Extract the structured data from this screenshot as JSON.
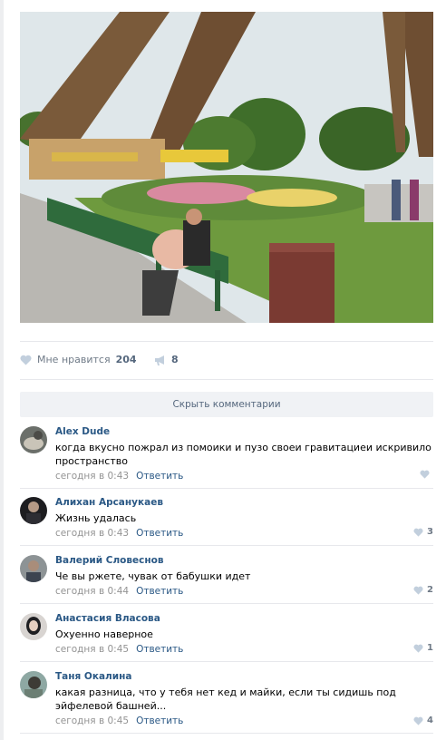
{
  "post": {
    "actions": {
      "like_label": "Мне нравится",
      "like_count": "204",
      "share_count": "8"
    },
    "hide_comments_label": "Скрыть комментарии"
  },
  "comments": [
    {
      "author": "Alex Dude",
      "text": "когда вкусно пожрал из помоики и пузо своеи гравитациеи искривило пространство",
      "time": "сегодня в 0:43",
      "reply": "Ответить",
      "likes": ""
    },
    {
      "author": "Алихан Арсанукаев",
      "text": "Жизнь удалась",
      "time": "сегодня в 0:43",
      "reply": "Ответить",
      "likes": "3"
    },
    {
      "author": "Валерий Словеснов",
      "text": "Че вы ржете, чувак от бабушки идет",
      "time": "сегодня в 0:44",
      "reply": "Ответить",
      "likes": "2"
    },
    {
      "author": "Анастасия Власова",
      "text": "Охуенно наверное",
      "time": "сегодня в 0:45",
      "reply": "Ответить",
      "likes": "1"
    },
    {
      "author": "Таня Окалина",
      "text": "какая разница, что у тебя нет кед и майки, если ты сидишь под эйфелевой башней...",
      "time": "сегодня в 0:45",
      "reply": "Ответить",
      "likes": "4"
    }
  ],
  "colors": {
    "link": "#2a5885",
    "muted": "#939393",
    "accent": "#55677d"
  }
}
